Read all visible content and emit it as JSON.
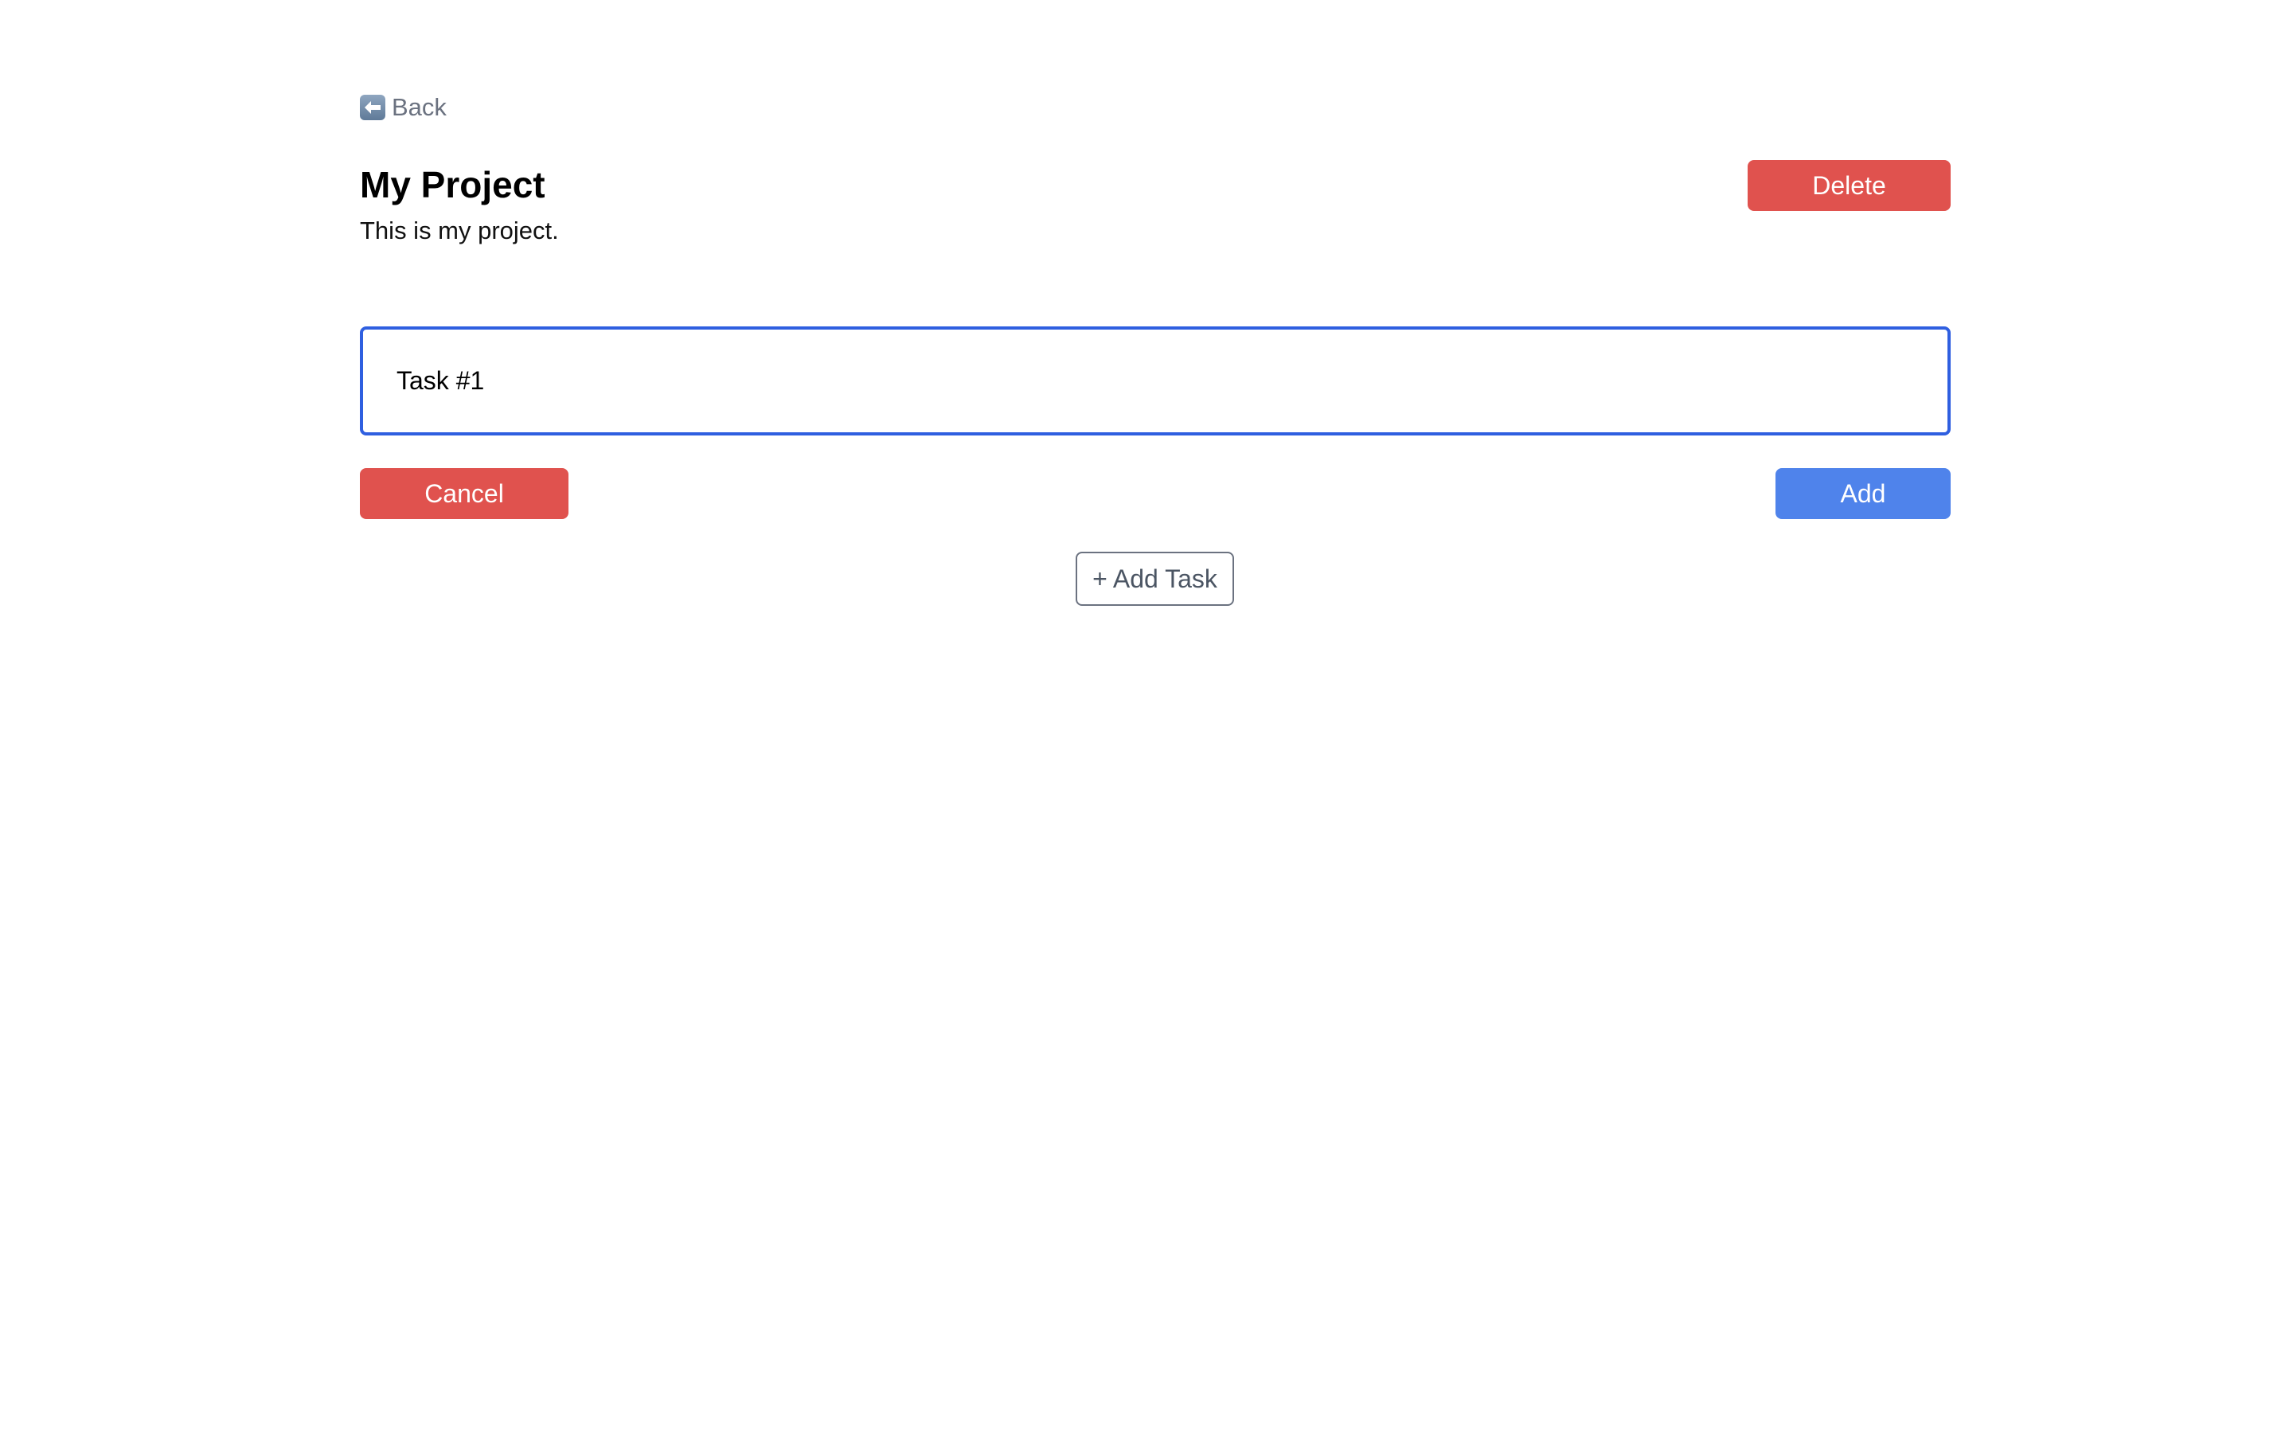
{
  "nav": {
    "back_label": "Back",
    "back_icon": "back-arrow-icon"
  },
  "project": {
    "title": "My Project",
    "description": "This is my project.",
    "delete_label": "Delete"
  },
  "task_form": {
    "input_value": "Task #1",
    "cancel_label": "Cancel",
    "add_label": "Add"
  },
  "add_task_label": "+ Add Task",
  "colors": {
    "danger": "#e0524e",
    "primary": "#4f83eb",
    "focus_border": "#2f5fe0",
    "muted_text": "#6b7280"
  }
}
